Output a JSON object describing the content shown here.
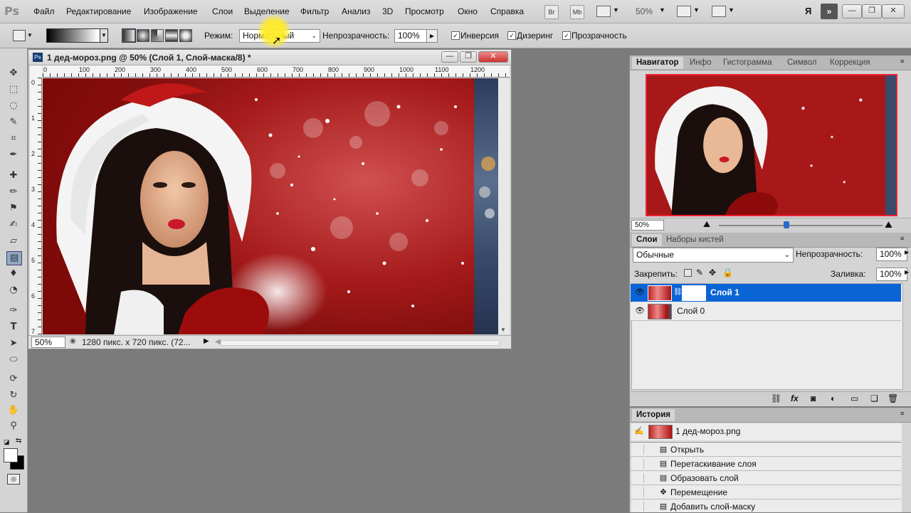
{
  "app": {
    "logo": "Ps"
  },
  "menu": [
    "Файл",
    "Редактирование",
    "Изображение",
    "Слои",
    "Выделение",
    "Фильтр",
    "Анализ",
    "3D",
    "Просмотр",
    "Окно",
    "Справка"
  ],
  "toolbar_right": {
    "br": "Br",
    "mb": "Mb",
    "zoom": "50%",
    "workspace": "Я"
  },
  "options": {
    "mode_label": "Режим:",
    "mode_value": "Нормальный",
    "opacity_label": "Непрозрачность:",
    "opacity_value": "100%",
    "invert": "Инверсия",
    "dither": "Дизеринг",
    "transparency": "Прозрачность"
  },
  "document": {
    "title": "1 дед-мороз.png @ 50% (Слой 1, Слой-маска/8) *",
    "ruler_h": [
      "0",
      "100",
      "200",
      "300",
      "400",
      "500",
      "600",
      "700",
      "800",
      "900",
      "1000",
      "1100",
      "1200"
    ],
    "ruler_v": [
      "0",
      "1",
      "2",
      "3",
      "4",
      "5",
      "6",
      "7"
    ],
    "zoom": "50%",
    "status": "1280 пикс. x 720 пикс. (72..."
  },
  "navigator": {
    "tabs": [
      "Навигатор",
      "Инфо",
      "Гистограмма",
      "Символ",
      "Коррекция"
    ],
    "zoom": "50%"
  },
  "layers": {
    "tabs": [
      "Слои",
      "Наборы кистей"
    ],
    "blend": "Обычные",
    "opacity_label": "Непрозрачность:",
    "opacity_value": "100%",
    "lock_label": "Закрепить:",
    "fill_label": "Заливка:",
    "fill_value": "100%",
    "items": [
      {
        "name": "Слой 1"
      },
      {
        "name": "Слой 0"
      }
    ]
  },
  "history": {
    "tab": "История",
    "snapshot": "1 дед-мороз.png",
    "steps": [
      "Открыть",
      "Перетаскивание слоя",
      "Образовать слой",
      "Перемещение",
      "Добавить слой-маску"
    ]
  },
  "colors": {
    "accent": "#0a64d6",
    "selection_text": "#ffffff",
    "ps_red": "#b01515"
  }
}
